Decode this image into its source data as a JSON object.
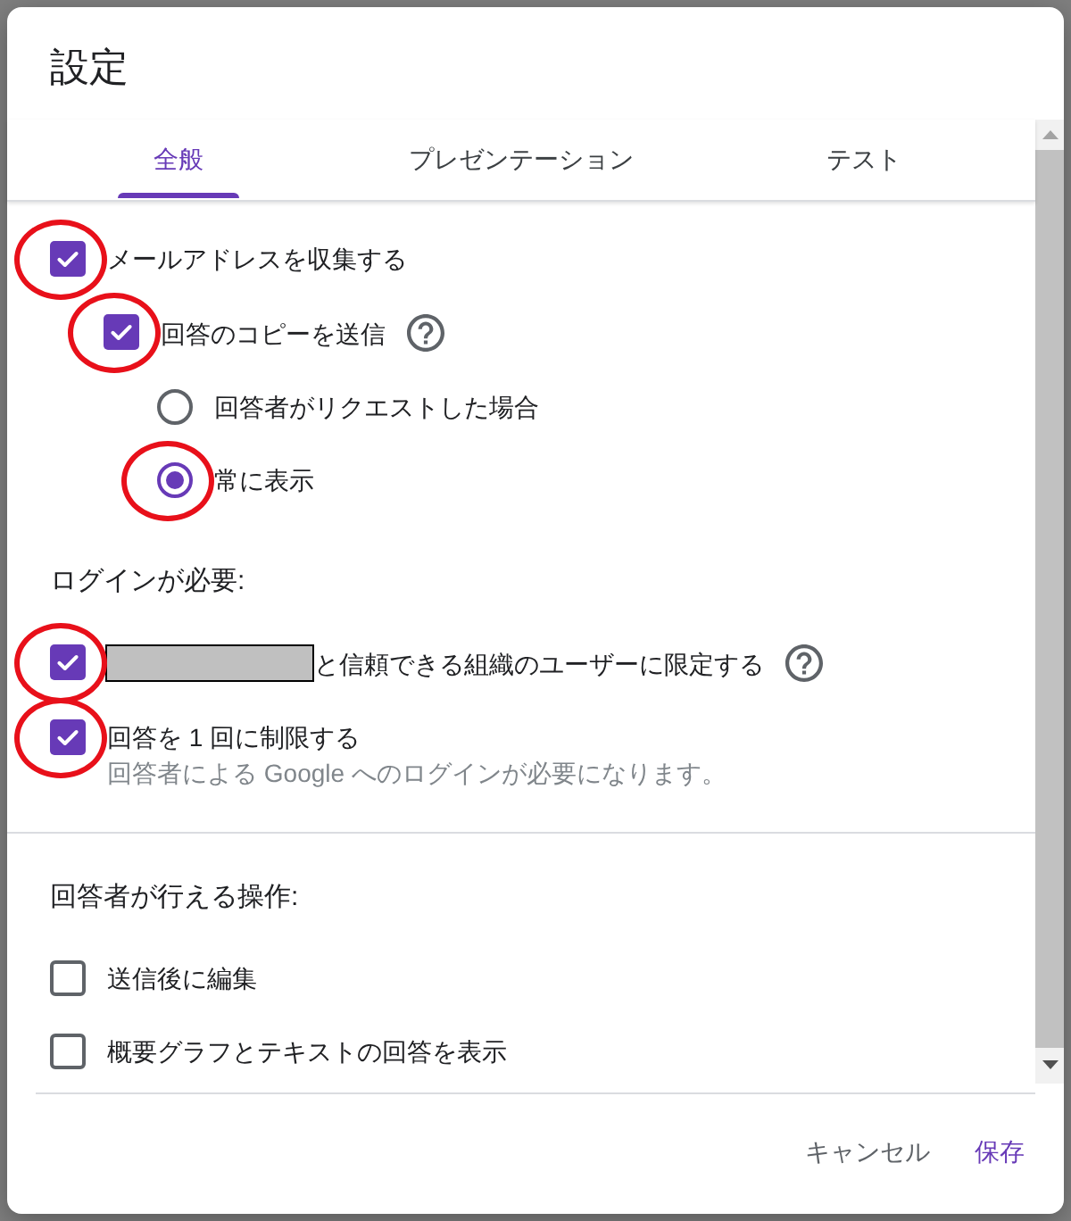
{
  "dialog": {
    "title": "設定"
  },
  "tabs": [
    {
      "label": "全般",
      "selected": true
    },
    {
      "label": "プレゼンテーション",
      "selected": false
    },
    {
      "label": "テスト",
      "selected": false
    }
  ],
  "sections": [
    {
      "divider_above": false,
      "items": [
        {
          "kind": "checkbox",
          "label": "メールアドレスを収集する",
          "checked": true,
          "circled": true,
          "children": [
            {
              "kind": "checkbox",
              "label": "回答のコピーを送信",
              "checked": true,
              "circled": true,
              "help": true,
              "children": [
                {
                  "kind": "radio",
                  "label": "回答者がリクエストした場合",
                  "selected": false,
                  "circled": false
                },
                {
                  "kind": "radio",
                  "label": "常に表示",
                  "selected": true,
                  "circled": true
                }
              ]
            }
          ]
        }
      ]
    },
    {
      "heading": "ログインが必要:",
      "divider_above": false,
      "items": [
        {
          "kind": "checkbox",
          "label": "と信頼できる組織のユーザーに限定する",
          "checked": true,
          "circled": true,
          "redacted": true,
          "help": true
        },
        {
          "kind": "checkbox",
          "label": "回答を 1 回に制限する",
          "checked": true,
          "circled": true,
          "hint": "回答者による Google へのログインが必要になります。"
        }
      ]
    },
    {
      "heading": "回答者が行える操作:",
      "divider_above": true,
      "items": [
        {
          "kind": "checkbox",
          "label": "送信後に編集",
          "checked": false,
          "circled": false
        },
        {
          "kind": "checkbox",
          "label": "概要グラフとテキストの回答を表示",
          "checked": false,
          "circled": false
        }
      ]
    }
  ],
  "buttons": [
    {
      "label": "キャンセル",
      "kind": "secondary"
    },
    {
      "label": "保存",
      "kind": "primary"
    }
  ]
}
